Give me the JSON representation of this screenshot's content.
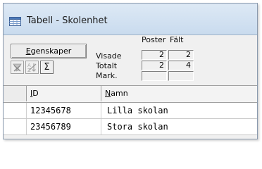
{
  "window": {
    "title": "Tabell - Skolenhet",
    "icon": "table-icon"
  },
  "toolbar": {
    "properties_button": {
      "label_prefix": "",
      "mnemonic": "E",
      "label_rest": "genskaper"
    },
    "tool_buttons": [
      {
        "icon": "clear-filter-icon",
        "glyph": "✕",
        "enabled": false
      },
      {
        "icon": "sort-az-icon",
        "glyph": "A",
        "enabled": false
      },
      {
        "icon": "sum-icon",
        "glyph": "Σ",
        "enabled": true
      }
    ]
  },
  "stats": {
    "col_headers": [
      "Poster",
      "Fält"
    ],
    "rows": [
      {
        "label": "Visade",
        "poster": "2",
        "falt": "2"
      },
      {
        "label": "Totalt",
        "poster": "2",
        "falt": "4"
      },
      {
        "label": "Mark.",
        "poster": "",
        "falt": ""
      }
    ]
  },
  "grid": {
    "columns": [
      {
        "mnemonic": "I",
        "rest": "D"
      },
      {
        "mnemonic": "N",
        "rest": "amn"
      }
    ],
    "rows": [
      {
        "id": "12345678",
        "namn": "Lilla skolan"
      },
      {
        "id": "23456789",
        "namn": "Stora skolan"
      }
    ]
  }
}
